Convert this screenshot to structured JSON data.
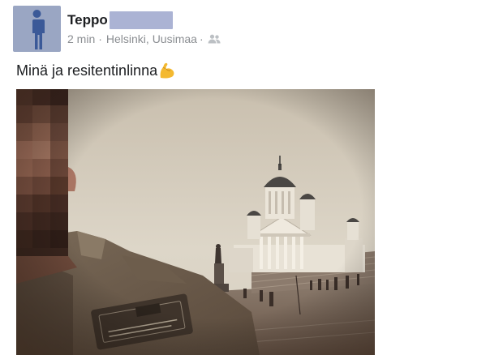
{
  "post": {
    "author_name": "Teppo",
    "time": "2 min",
    "separator": "·",
    "location": "Helsinki, Uusimaa",
    "dot": "·",
    "audience_icon": "friends-icon",
    "text": "Minä ja resitentinlinna",
    "emoji": "flexed-biceps-icon",
    "avatar_icon": "default-person-icon",
    "photo_subject": "selfie-photo"
  },
  "colors": {
    "avatar_bg": "#9aa6c3",
    "avatar_figure": "#3b5998",
    "redaction": "#abb3d4",
    "meta_text": "#8a8d91",
    "body_text": "#1c1e21"
  }
}
